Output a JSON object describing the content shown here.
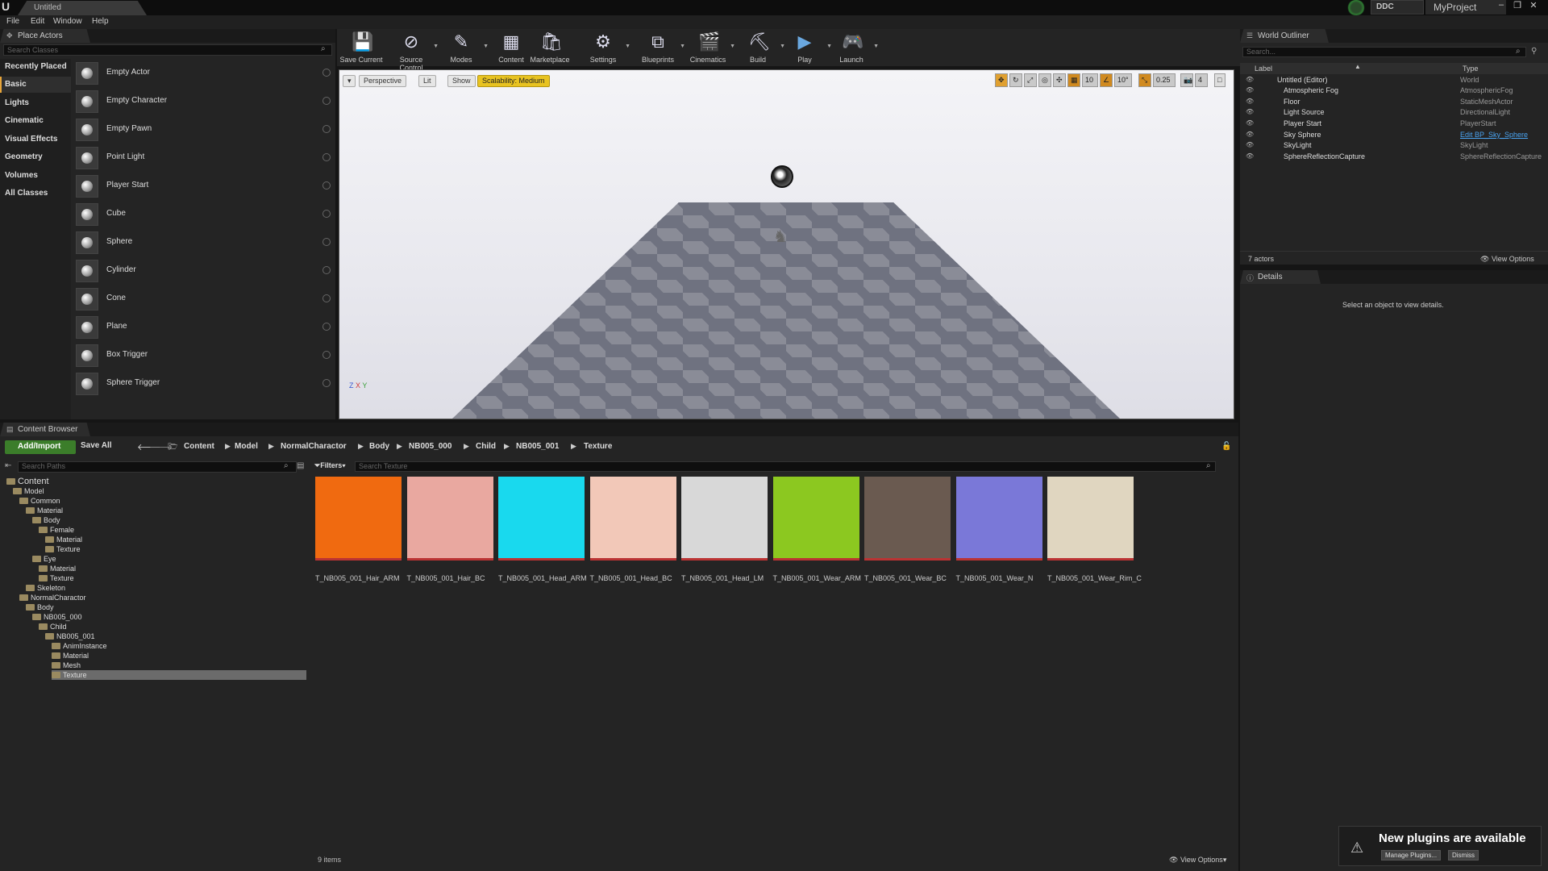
{
  "window": {
    "tab_title": "Untitled",
    "project": "MyProject",
    "ddc": "DDC",
    "controls": {
      "minimize": "–",
      "maximize": "❐",
      "close": "✕"
    }
  },
  "menu": [
    "File",
    "Edit",
    "Window",
    "Help"
  ],
  "place_actors": {
    "tab_label": "Place Actors",
    "search_placeholder": "Search Classes",
    "categories": [
      "Recently Placed",
      "Basic",
      "Lights",
      "Cinematic",
      "Visual Effects",
      "Geometry",
      "Volumes",
      "All Classes"
    ],
    "active_category": "Basic",
    "actors": [
      "Empty Actor",
      "Empty Character",
      "Empty Pawn",
      "Point Light",
      "Player Start",
      "Cube",
      "Sphere",
      "Cylinder",
      "Cone",
      "Plane",
      "Box Trigger",
      "Sphere Trigger"
    ]
  },
  "toolbar": {
    "items": [
      "Save Current",
      "Source Control",
      "Modes",
      "Content",
      "Marketplace",
      "Settings",
      "Blueprints",
      "Cinematics",
      "Build",
      "Play",
      "Launch"
    ]
  },
  "viewport": {
    "perspective": "Perspective",
    "lit": "Lit",
    "show": "Show",
    "scalability": "Scalability: Medium",
    "grid_snap": "10",
    "rot_snap": "10°",
    "scale_snap": "0.25",
    "camera_speed": "4",
    "axis": {
      "z": "Z",
      "x": "X",
      "y": "Y"
    }
  },
  "outliner": {
    "tab_label": "World Outliner",
    "search_placeholder": "Search...",
    "col_label": "Label",
    "col_type": "Type",
    "rows": [
      {
        "label": "Untitled (Editor)",
        "type": "World"
      },
      {
        "label": "Atmospheric Fog",
        "type": "AtmosphericFog"
      },
      {
        "label": "Floor",
        "type": "StaticMeshActor"
      },
      {
        "label": "Light Source",
        "type": "DirectionalLight"
      },
      {
        "label": "Player Start",
        "type": "PlayerStart"
      },
      {
        "label": "Sky Sphere",
        "type": "Edit BP_Sky_Sphere"
      },
      {
        "label": "SkyLight",
        "type": "SkyLight"
      },
      {
        "label": "SphereReflectionCapture",
        "type": "SphereReflectionCapture"
      }
    ],
    "actor_count": "7 actors",
    "view_options": "View Options"
  },
  "details": {
    "tab_label": "Details",
    "empty_text": "Select an object to view details."
  },
  "content_browser": {
    "tab_label": "Content Browser",
    "add_import": "Add/Import",
    "save_all": "Save All",
    "breadcrumb": [
      "Content",
      "Model",
      "NormalCharactor",
      "Body",
      "NB005_000",
      "Child",
      "NB005_001",
      "Texture"
    ],
    "path_search_placeholder": "Search Paths",
    "filters": "Filters",
    "asset_search_placeholder": "Search Texture",
    "tree": [
      {
        "label": "Content",
        "depth": 0
      },
      {
        "label": "Model",
        "depth": 1
      },
      {
        "label": "Common",
        "depth": 2
      },
      {
        "label": "Material",
        "depth": 3
      },
      {
        "label": "Body",
        "depth": 4
      },
      {
        "label": "Female",
        "depth": 5
      },
      {
        "label": "Material",
        "depth": 6
      },
      {
        "label": "Texture",
        "depth": 6
      },
      {
        "label": "Eye",
        "depth": 4
      },
      {
        "label": "Material",
        "depth": 5
      },
      {
        "label": "Texture",
        "depth": 5
      },
      {
        "label": "Skeleton",
        "depth": 3
      },
      {
        "label": "NormalCharactor",
        "depth": 2
      },
      {
        "label": "Body",
        "depth": 3
      },
      {
        "label": "NB005_000",
        "depth": 4
      },
      {
        "label": "Child",
        "depth": 5
      },
      {
        "label": "NB005_001",
        "depth": 6
      },
      {
        "label": "AnimInstance",
        "depth": 7
      },
      {
        "label": "Material",
        "depth": 7
      },
      {
        "label": "Mesh",
        "depth": 7
      },
      {
        "label": "Texture",
        "depth": 7
      }
    ],
    "assets": [
      {
        "name": "T_NB005_001_Hair_ARM",
        "color": "#f06a10"
      },
      {
        "name": "T_NB005_001_Hair_BC",
        "color": "#e9a8a0"
      },
      {
        "name": "T_NB005_001_Head_ARM",
        "color": "#19d9ee"
      },
      {
        "name": "T_NB005_001_Head_BC",
        "color": "#f2c8b8"
      },
      {
        "name": "T_NB005_001_Head_LM",
        "color": "#d8d8d8"
      },
      {
        "name": "T_NB005_001_Wear_ARM",
        "color": "#8cc820"
      },
      {
        "name": "T_NB005_001_Wear_BC",
        "color": "#6a5a50"
      },
      {
        "name": "T_NB005_001_Wear_N",
        "color": "#7a78d8"
      },
      {
        "name": "T_NB005_001_Wear_Rim_C",
        "color": "#e0d6c0"
      }
    ],
    "item_count": "9 items",
    "view_options": "View Options"
  },
  "notification": {
    "title": "New plugins are available",
    "manage": "Manage Plugins...",
    "dismiss": "Dismiss"
  }
}
